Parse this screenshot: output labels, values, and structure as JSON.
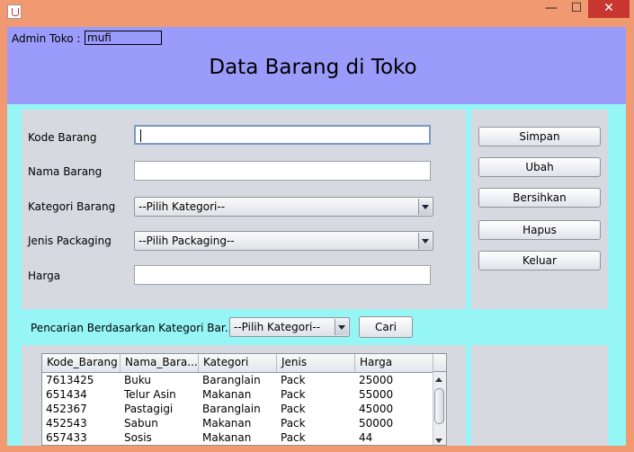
{
  "window": {
    "minimize": "—",
    "maximize": "☐",
    "close": "✕",
    "app_icon": "java-icon"
  },
  "header": {
    "admin_label": "Admin Toko :",
    "admin_value": "mufi",
    "title": "Data Barang di Toko"
  },
  "form": {
    "kode_label": "Kode Barang",
    "kode_value": "",
    "nama_label": "Nama Barang",
    "nama_value": "",
    "kategori_label": "Kategori Barang",
    "kategori_selected": "--Pilih Kategori--",
    "packaging_label": "Jenis Packaging",
    "packaging_selected": "--Pilih Packaging--",
    "harga_label": "Harga",
    "harga_value": ""
  },
  "buttons": {
    "simpan": "Simpan",
    "ubah": "Ubah",
    "bersihkan": "Bersihkan",
    "hapus": "Hapus",
    "keluar": "Keluar"
  },
  "search": {
    "label": "Pencarian Berdasarkan Kategori Bar...",
    "selected": "--Pilih Kategori--",
    "button": "Cari"
  },
  "table": {
    "columns": [
      "Kode_Barang",
      "Nama_Bara...",
      "Kategori",
      "Jenis",
      "Harga"
    ],
    "rows": [
      [
        "7613425",
        "Buku",
        "Baranglain",
        "Pack",
        "25000"
      ],
      [
        "651434",
        "Telur Asin",
        "Makanan",
        "Pack",
        "55000"
      ],
      [
        "452367",
        "Pastagigi",
        "Baranglain",
        "Pack",
        "45000"
      ],
      [
        "452543",
        "Sabun",
        "Makanan",
        "Pack",
        "50000"
      ],
      [
        "657433",
        "Sosis",
        "Makanan",
        "Pack",
        "44"
      ]
    ]
  },
  "colors": {
    "window_frame": "#f19a72",
    "header_bg": "#9b9bfb",
    "content_bg": "#96f6f6",
    "panel_bg": "#d6d9df",
    "close_button": "#c7372f"
  }
}
